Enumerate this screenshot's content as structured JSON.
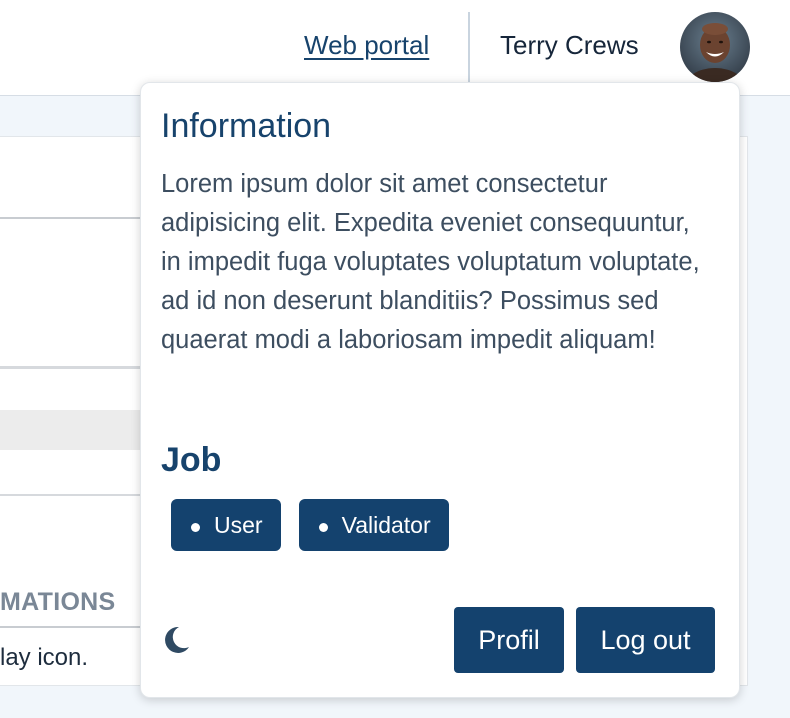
{
  "header": {
    "web_portal_label": "Web portal",
    "user_name": "Terry Crews"
  },
  "background": {
    "section_heading": "MATIONS",
    "text_fragment": "lay icon."
  },
  "popover": {
    "info_title": "Information",
    "info_body": "Lorem ipsum dolor sit amet consectetur adipisicing elit. Expedita eveniet consequuntur, in impedit fuga voluptates voluptatum voluptate, ad id non deserunt blanditiis? Possimus sed quaerat modi a laboriosam impedit aliquam!",
    "job_title": "Job",
    "jobs": [
      "User",
      "Validator"
    ],
    "theme_toggle_icon": "moon-icon",
    "profil_label": "Profil",
    "logout_label": "Log out"
  },
  "colors": {
    "primary": "#14426e",
    "heading": "#17436c",
    "body_text": "#3d4e60",
    "page_bg": "#f1f6fb"
  }
}
